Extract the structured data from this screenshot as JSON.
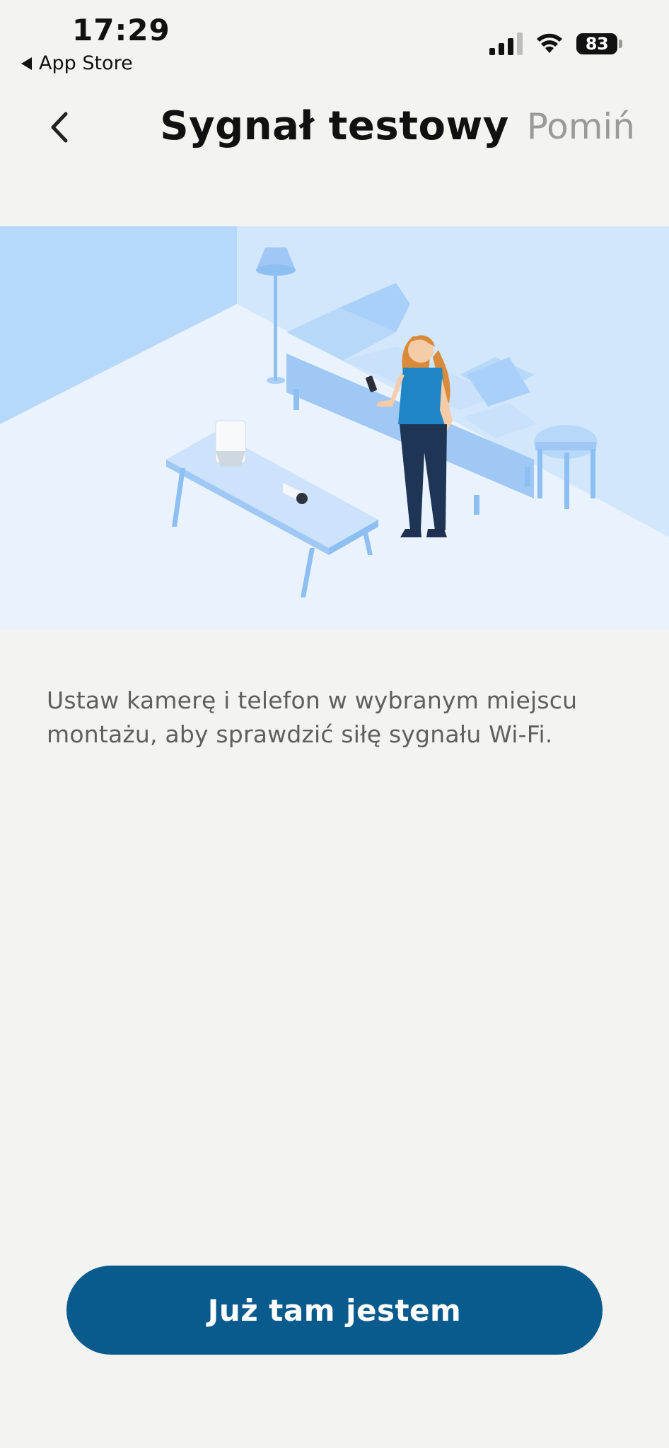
{
  "status_bar": {
    "time": "17:29",
    "back_app": "App Store",
    "battery": "83"
  },
  "nav": {
    "title": "Sygnał testowy",
    "skip_label": "Pomiń",
    "back_icon": "chevron-left-icon"
  },
  "illustration": {
    "icon": "room-setup-illustration"
  },
  "content": {
    "instruction": "Ustaw kamerę i telefon w wybranym miejscu montażu, aby sprawdzić siłę sygnału Wi-Fi."
  },
  "actions": {
    "primary_label": "Już tam jestem"
  },
  "colors": {
    "accent": "#085b8c",
    "background": "#f3f3f1",
    "muted_text": "#5f5f5f"
  }
}
